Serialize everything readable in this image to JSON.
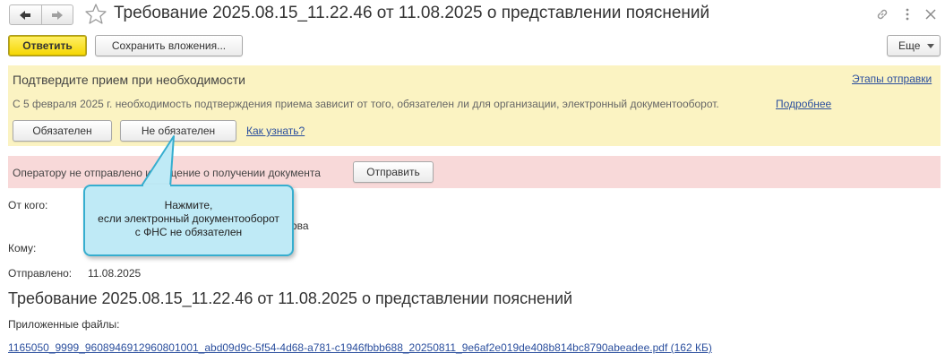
{
  "window": {
    "title": "Требование 2025.08.15_11.22.46 от 11.08.2025 о представлении пояснений"
  },
  "toolbar": {
    "reply_label": "Ответить",
    "save_attachments_label": "Сохранить вложения...",
    "more_label": "Еще"
  },
  "confirm_panel": {
    "heading": "Подтвердите прием при необходимости",
    "stages_link": "Этапы отправки",
    "description": "С 5 февраля 2025 г. необходимость подтверждения приема зависит от того, обязателен ли для организации, электронный документооборот.",
    "more_link": "Подробнее",
    "required_label": "Обязателен",
    "not_required_label": "Не обязателен",
    "how_to_know_link": "Как узнать?"
  },
  "notice_panel": {
    "message": "Оператору не отправлено извещение о получении документа",
    "send_label": "Отправить"
  },
  "tooltip": {
    "line1": "Нажмите,",
    "line2": "если электронный документооборот",
    "line3": "с ФНС не обязателен"
  },
  "details": {
    "from_label": "От кого:",
    "from_value_partial": "ова",
    "to_label": "Кому:",
    "sent_label": "Отправлено:",
    "sent_value": "11.08.2025"
  },
  "document": {
    "heading": "Требование 2025.08.15_11.22.46 от 11.08.2025 о представлении пояснений",
    "attachments_label": "Приложенные файлы:",
    "attachment_link": "1165050_9999_9608946912960801001_abd09d9c-5f54-4d68-a781-c1946fbbb688_20250811_9e6af2e019de408b814bc8790abeadee.pdf (162 КБ)"
  },
  "colors": {
    "accent_yellow": "#f5d600",
    "confirm_panel_bg": "#fbf3c2",
    "notice_panel_bg": "#f8d9d9",
    "tooltip_bg": "#bfeaf6",
    "tooltip_border": "#36aecf",
    "link": "#2b4f9e"
  },
  "icons": [
    "arrow-left-icon",
    "arrow-right-icon",
    "star-icon",
    "link-icon",
    "more-vertical-icon",
    "close-icon",
    "chevron-down-icon"
  ]
}
